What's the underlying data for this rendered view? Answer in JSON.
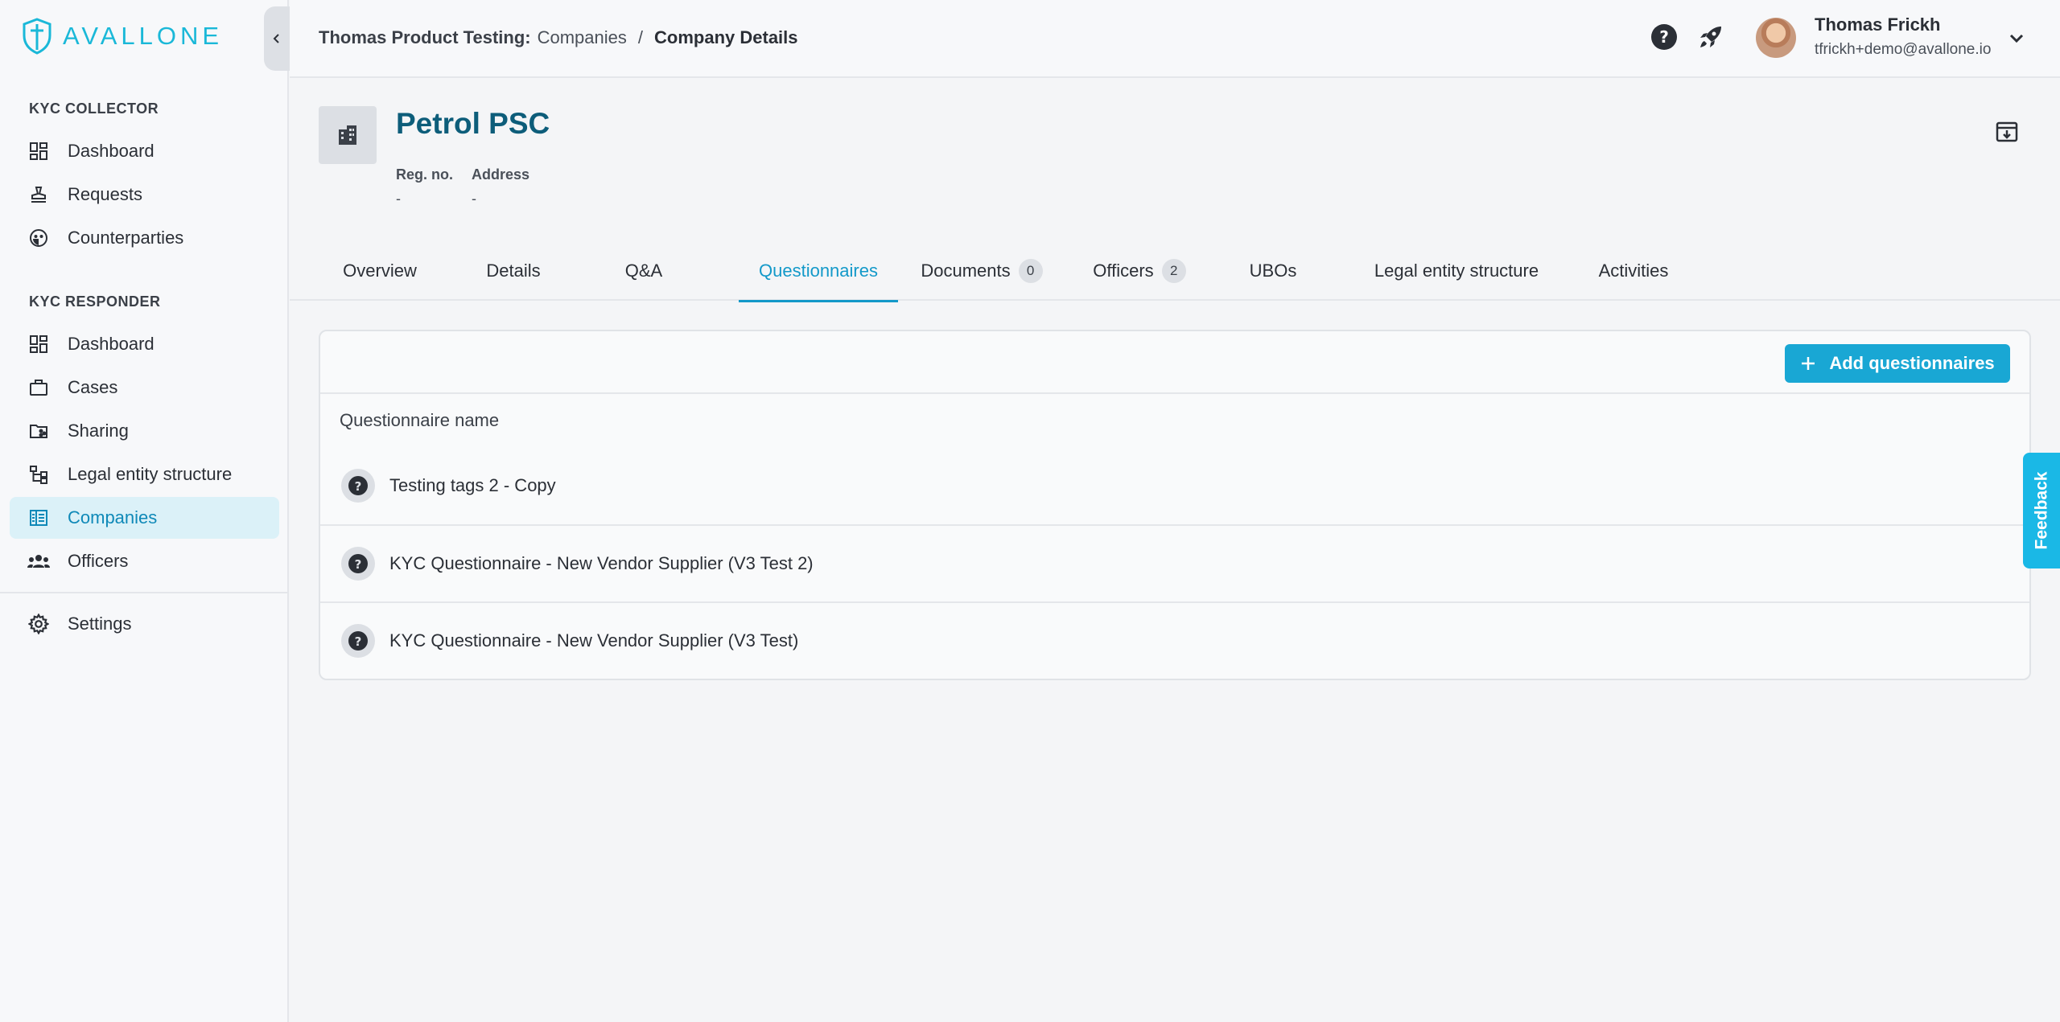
{
  "brand": {
    "name": "AVALLONE",
    "color": "#1ab8d8"
  },
  "sidebar": {
    "collector_title": "KYC COLLECTOR",
    "collector_items": [
      {
        "label": "Dashboard",
        "icon": "dashboard-icon"
      },
      {
        "label": "Requests",
        "icon": "stamp-icon"
      },
      {
        "label": "Counterparties",
        "icon": "face-icon"
      }
    ],
    "responder_title": "KYC RESPONDER",
    "responder_items": [
      {
        "label": "Dashboard",
        "icon": "dashboard-icon"
      },
      {
        "label": "Cases",
        "icon": "briefcase-icon"
      },
      {
        "label": "Sharing",
        "icon": "shared-folder-icon"
      },
      {
        "label": "Legal entity structure",
        "icon": "tree-icon"
      },
      {
        "label": "Companies",
        "icon": "building-list-icon",
        "active": true
      },
      {
        "label": "Officers",
        "icon": "group-icon"
      }
    ],
    "settings_label": "Settings"
  },
  "header": {
    "breadcrumb_prefix": "Thomas Product Testing:",
    "breadcrumb_link": "Companies",
    "breadcrumb_sep": "/",
    "breadcrumb_current": "Company Details",
    "user_name": "Thomas Frickh",
    "user_email": "tfrickh+demo@avallone.io"
  },
  "company": {
    "name": "Petrol PSC",
    "reg_label": "Reg. no.",
    "reg_value": "-",
    "address_label": "Address",
    "address_value": "-"
  },
  "tabs": [
    {
      "label": "Overview"
    },
    {
      "label": "Details"
    },
    {
      "label": "Q&A"
    },
    {
      "label": "Questionnaires",
      "active": true
    },
    {
      "label": "Documents",
      "badge": "0"
    },
    {
      "label": "Officers",
      "badge": "2"
    },
    {
      "label": "UBOs"
    },
    {
      "label": "Legal entity structure"
    },
    {
      "label": "Activities"
    }
  ],
  "questionnaires": {
    "add_label": "Add questionnaires",
    "column_header": "Questionnaire name",
    "rows": [
      {
        "name": "Testing tags 2 - Copy"
      },
      {
        "name": "KYC Questionnaire - New Vendor Supplier (V3 Test 2)"
      },
      {
        "name": "KYC Questionnaire - New Vendor Supplier (V3 Test)"
      }
    ]
  },
  "feedback_label": "Feedback",
  "colors": {
    "accent": "#1399c9",
    "button": "#19a7d4",
    "title": "#0d5d7a",
    "active_bg": "#dbf1f8"
  }
}
